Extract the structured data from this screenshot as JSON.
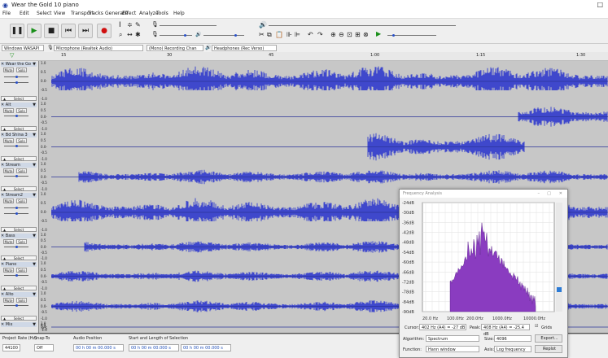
{
  "window": {
    "title": "Wear the Gold 10 piano",
    "close_glyph": "□"
  },
  "menu": [
    "File",
    "Edit",
    "Select",
    "View",
    "Transport",
    "Tracks",
    "Generate",
    "Effect",
    "Analyze",
    "Tools",
    "Help"
  ],
  "devices": {
    "host": "Windows WASAPI",
    "recording": "Microphone (Realtek Audio)",
    "channels": "(Mono) Recording Chan",
    "playback": "Headphones (Rec Verso)"
  },
  "ruler": {
    "marks": [
      "15",
      "30",
      "45",
      "1:00",
      "1:15",
      "1:30"
    ]
  },
  "tracks": [
    {
      "name": "Wear the Go"
    },
    {
      "name": "Alt"
    },
    {
      "name": "Bd Shina 3"
    },
    {
      "name": "Stream"
    },
    {
      "name": "Stream2"
    },
    {
      "name": "Bass"
    },
    {
      "name": "Piano"
    },
    {
      "name": "Alto"
    },
    {
      "name": "Mix"
    }
  ],
  "track_labels": {
    "mute": "Mute",
    "solo": "Solo",
    "select": "Select"
  },
  "scale_labels": [
    "1.0",
    "0.5",
    "0.0-",
    "-0.5",
    "-1.0"
  ],
  "status": {
    "project_rate_label": "Project Rate (Hz)",
    "project_rate": "44100",
    "snap_label": "Snap-To",
    "snap_value": "Off",
    "audio_position_label": "Audio Position",
    "audio_position": "00 h 00 m 00.000 s",
    "selection_label": "Start and Length of Selection",
    "sel_start": "00 h 00 m 00.000 s",
    "sel_length": "00 h 00 m 00.000 s"
  },
  "frequency_analysis": {
    "title": "Frequency Analysis",
    "y_labels": [
      "-24dB",
      "-30dB",
      "-36dB",
      "-42dB",
      "-48dB",
      "-54dB",
      "-60dB",
      "-66dB",
      "-72dB",
      "-78dB",
      "-84dB",
      "-90dB"
    ],
    "x_labels": [
      "20.0 Hz",
      "100.0Hz",
      "200.0Hz",
      "1000.0Hz",
      "10000.0Hz"
    ],
    "cursor_label": "Cursor:",
    "cursor_value": "402 Hz (A4) = -27 dB",
    "peak_label": "Peak:",
    "peak_value": "408 Hz (A4) = -25.4 dB",
    "grids_label": "Grids",
    "algorithm_label": "Algorithm:",
    "algorithm": "Spectrum",
    "size_label": "Size:",
    "size": "4096",
    "function_label": "Function:",
    "function": "Hann window",
    "axis_label": "Axis:",
    "axis": "Log frequency",
    "export": "Export...",
    "replot": "Replot"
  },
  "colors": {
    "wave": "#3f48cc",
    "wave_dark": "#2b3399",
    "spectrum": "#8a3cc0",
    "track_bg": "#c7c7c7"
  }
}
